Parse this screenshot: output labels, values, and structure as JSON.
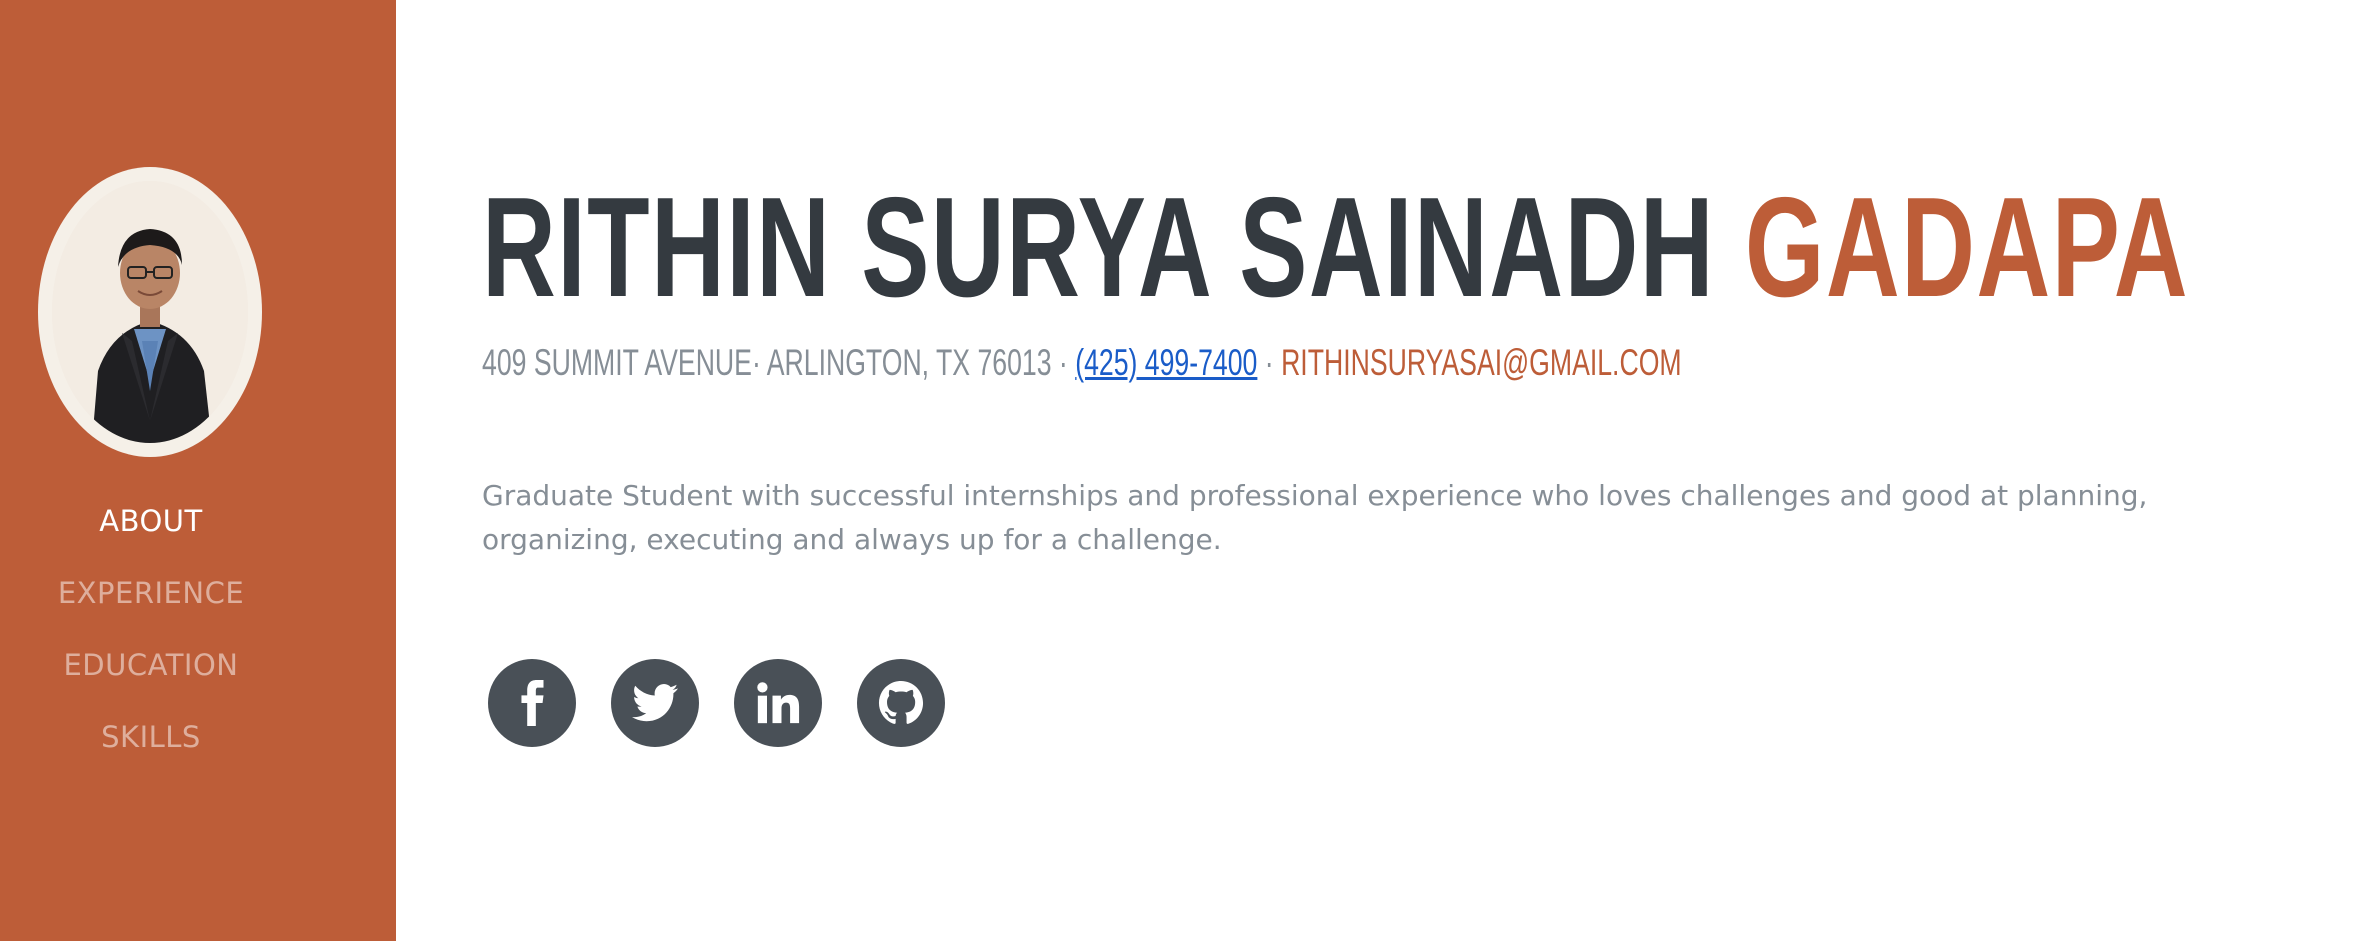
{
  "sidebar": {
    "nav": [
      {
        "label": "ABOUT"
      },
      {
        "label": "EXPERIENCE"
      },
      {
        "label": "EDUCATION"
      },
      {
        "label": "SKILLS"
      }
    ],
    "active_item": "ABOUT"
  },
  "header": {
    "first_name": "RITHIN SURYA SAINADH",
    "last_name": "GADAPA"
  },
  "contact": {
    "address": "409 SUMMIT AVENUE· ARLINGTON, TX 76013 ·",
    "phone": "(425) 499-7400",
    "separator": "·",
    "email": "RITHINSURYASAI@GMAIL.COM"
  },
  "about": {
    "text": "Graduate Student with successful internships and professional experience who loves challenges and good at planning, organizing, executing and always up for a challenge."
  },
  "social": [
    {
      "icon": "facebook-icon"
    },
    {
      "icon": "twitter-icon"
    },
    {
      "icon": "linkedin-icon"
    },
    {
      "icon": "github-icon"
    }
  ],
  "colors": {
    "primary": "#bd5d38",
    "heading": "#343a40",
    "muted": "#868e96",
    "link": "#1a5cc8",
    "social_bg": "#495057"
  }
}
